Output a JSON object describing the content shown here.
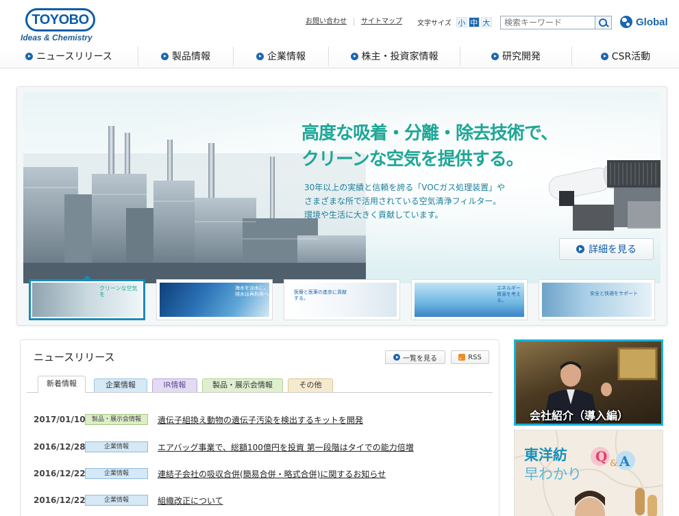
{
  "header": {
    "logo_text": "TOYOBO",
    "tagline": "Ideas & Chemistry",
    "util_links": [
      "お問い合わせ",
      "サイトマップ"
    ],
    "font_size": {
      "label": "文字サイズ",
      "options": [
        "小",
        "中",
        "大"
      ],
      "active": "中"
    },
    "search": {
      "placeholder": "検索キーワード"
    },
    "global_label": "Global"
  },
  "nav": {
    "items": [
      {
        "label": "ニュースリリース"
      },
      {
        "label": "製品情報"
      },
      {
        "label": "企業情報"
      },
      {
        "label": "株主・投資家情報"
      },
      {
        "label": "研究開発"
      },
      {
        "label": "CSR活動"
      }
    ]
  },
  "hero": {
    "title_line1": "高度な吸着・分離・除去技術で、",
    "title_line2": "クリーンな空気を提供する。",
    "text_line1": "30年以上の実績と信頼を誇る「VOCガス処理装置」や",
    "text_line2": "さまざまな所で活用されている空気清浄フィルター。",
    "text_line3": "環境や生活に大きく貢献しています。",
    "detail_button": "詳細を見る"
  },
  "thumbs": [
    {
      "label": "クリーンな空気を",
      "active": true
    },
    {
      "label": "海水を淡水に。排水は再利用へ",
      "active": false
    },
    {
      "label": "医療と医薬の進歩に貢献する。",
      "active": false
    },
    {
      "label": "エネルギー資源を考える。",
      "active": false
    },
    {
      "label": "安全と快適をサポート",
      "active": false
    }
  ],
  "news": {
    "title": "ニュースリリース",
    "list_button": "一覧を見る",
    "rss_button": "RSS",
    "tabs": [
      {
        "label": "新着情報",
        "color": "#ffffff"
      },
      {
        "label": "企業情報",
        "color": "#d6e9f7"
      },
      {
        "label": "IR情報",
        "color": "#e3dbf2"
      },
      {
        "label": "製品・展示会情報",
        "color": "#e0efd0"
      },
      {
        "label": "その他",
        "color": "#f5ead0"
      }
    ],
    "rows": [
      {
        "date": "2017/01/10",
        "category": "製品・展示会情報",
        "category_color": "#dcedc8",
        "category_border": "#9fc77a",
        "title": "遺伝子組換え動物の遺伝子汚染を検出するキットを開発"
      },
      {
        "date": "2016/12/28",
        "category": "企業情報",
        "category_color": "#d4e8f6",
        "category_border": "#8db9dc",
        "title": "エアバッグ事業で、総額100億円を投資 第一段階はタイでの能力倍増"
      },
      {
        "date": "2016/12/22",
        "category": "企業情報",
        "category_color": "#d4e8f6",
        "category_border": "#8db9dc",
        "title": "連結子会社の吸収合併(簡易合併・略式合併)に関するお知らせ"
      },
      {
        "date": "2016/12/22",
        "category": "企業情報",
        "category_color": "#d4e8f6",
        "category_border": "#8db9dc",
        "title": "組織改正について"
      }
    ]
  },
  "side": {
    "video_caption": "会社紹介（導入編）",
    "qa_line1": "東洋紡",
    "qa_line2": "早わかり",
    "qa_q": "Q",
    "qa_amp": "&",
    "qa_a": "A"
  },
  "colors": {
    "brand": "#0b5ca8",
    "accent_teal": "#1ea696",
    "link_blue": "#1a66b0"
  }
}
